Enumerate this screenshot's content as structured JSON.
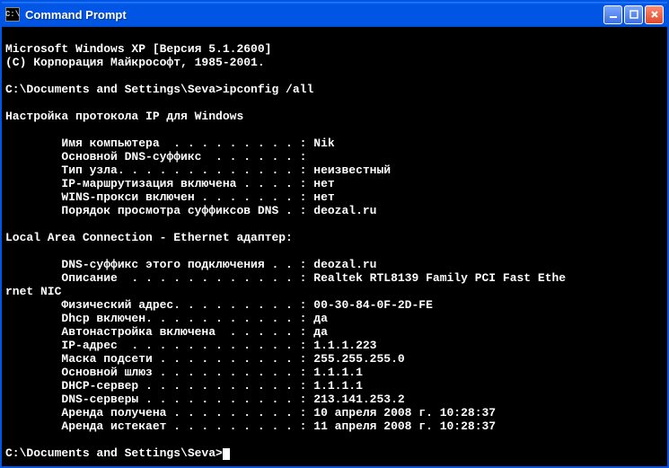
{
  "window": {
    "title": "Command Prompt",
    "icon_label": "C:\\"
  },
  "terminal": {
    "header1": "Microsoft Windows XP [Версия 5.1.2600]",
    "header2": "(С) Корпорация Майкрософт, 1985-2001.",
    "prompt1_path": "C:\\Documents and Settings\\Seva>",
    "prompt1_cmd": "ipconfig /all",
    "section1_title": "Настройка протокола IP для Windows",
    "s1": {
      "host_label": "        Имя компьютера  . . . . . . . . . : ",
      "host_value": "Nik",
      "dns_suffix_label": "        Основной DNS-суффикс  . . . . . . :",
      "dns_suffix_value": "",
      "node_label": "        Тип узла. . . . . . . . . . . . . : ",
      "node_value": "неизвестный",
      "routing_label": "        IP-маршрутизация включена . . . . : ",
      "routing_value": "нет",
      "wins_label": "        WINS-прокси включен . . . . . . . : ",
      "wins_value": "нет",
      "search_label": "        Порядок просмотра суффиксов DNS . : ",
      "search_value": "deozal.ru"
    },
    "section2_title": "Local Area Connection - Ethernet адаптер:",
    "s2": {
      "conn_dns_label": "        DNS-суффикс этого подключения . . : ",
      "conn_dns_value": "deozal.ru",
      "desc_label": "        Описание  . . . . . . . . . . . . : ",
      "desc_value": "Realtek RTL8139 Family PCI Fast Ethe",
      "desc_wrap": "rnet NIC",
      "mac_label": "        Физический адрес. . . . . . . . . : ",
      "mac_value": "00-30-84-0F-2D-FE",
      "dhcp_en_label": "        Dhcp включен. . . . . . . . . . . : ",
      "dhcp_en_value": "да",
      "auto_label": "        Автонастройка включена  . . . . . : ",
      "auto_value": "да",
      "ip_label": "        IP-адрес  . . . . . . . . . . . . : ",
      "ip_value": "1.1.1.223",
      "mask_label": "        Маска подсети . . . . . . . . . . : ",
      "mask_value": "255.255.255.0",
      "gw_label": "        Основной шлюз . . . . . . . . . . : ",
      "gw_value": "1.1.1.1",
      "dhcp_srv_label": "        DHCP-сервер . . . . . . . . . . . : ",
      "dhcp_srv_value": "1.1.1.1",
      "dns_srv_label": "        DNS-серверы . . . . . . . . . . . : ",
      "dns_srv_value": "213.141.253.2",
      "lease_ob_label": "        Аренда получена . . . . . . . . . : ",
      "lease_ob_value": "10 апреля 2008 г. 10:28:37",
      "lease_ex_label": "        Аренда истекает . . . . . . . . . : ",
      "lease_ex_value": "11 апреля 2008 г. 10:28:37"
    },
    "prompt2_path": "C:\\Documents and Settings\\Seva>"
  }
}
